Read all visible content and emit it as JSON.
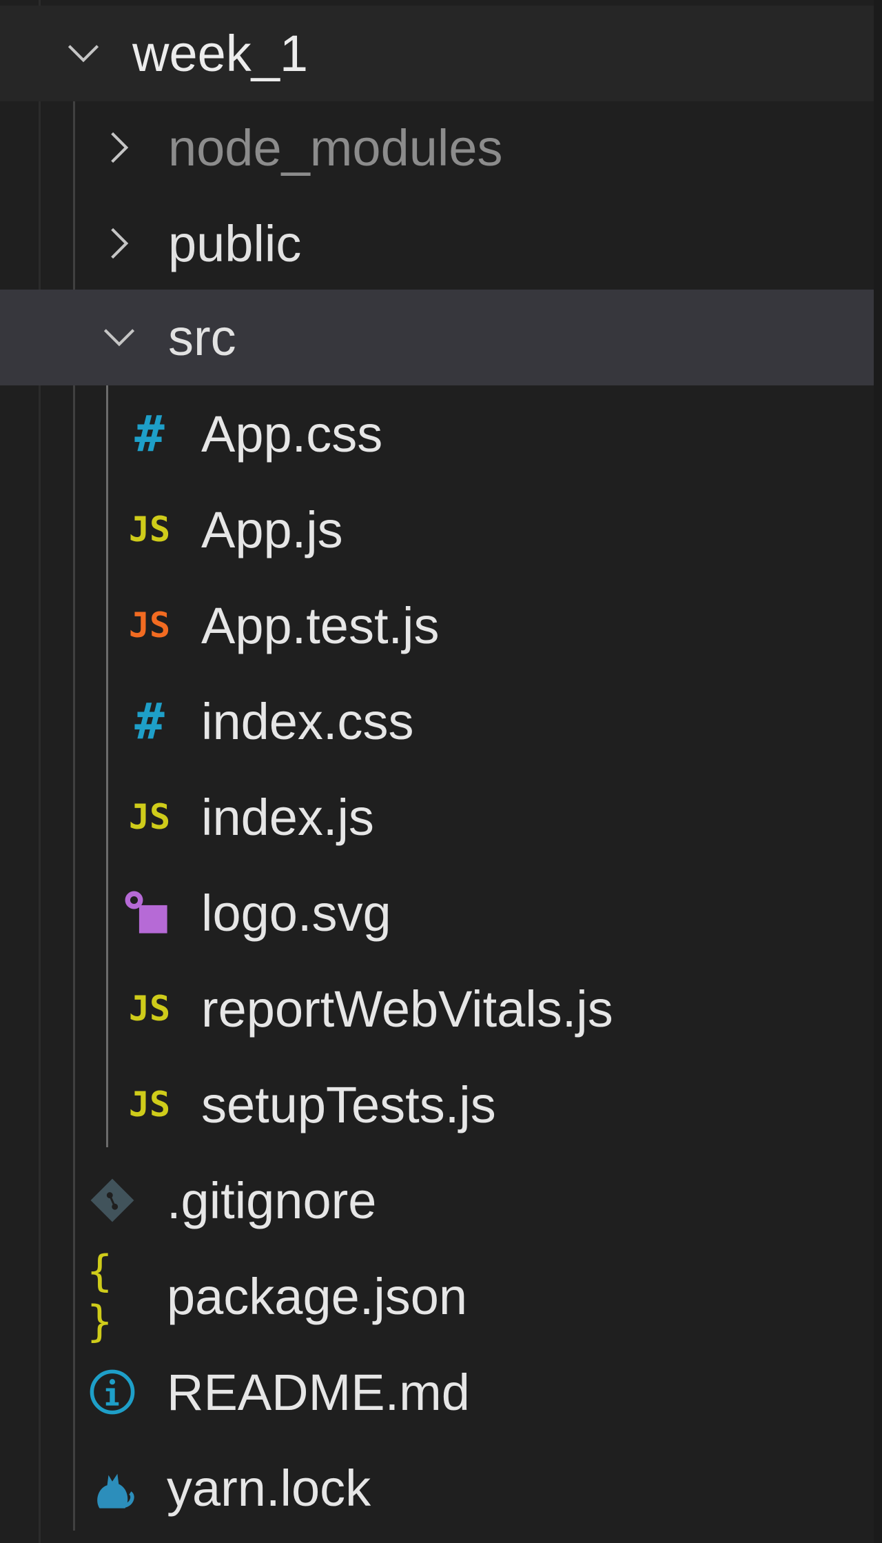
{
  "explorer": {
    "root": {
      "name": "week_1",
      "expanded": true
    },
    "folders": [
      {
        "name": "node_modules",
        "expanded": false,
        "ignored": true
      },
      {
        "name": "public",
        "expanded": false
      },
      {
        "name": "src",
        "expanded": true,
        "selected": true
      }
    ],
    "src_files": [
      {
        "name": "App.css",
        "icon": "css-hash-icon",
        "icon_glyph": "#",
        "icon_color": "#1e9fc8"
      },
      {
        "name": "App.js",
        "icon": "js-icon",
        "icon_glyph": "JS",
        "icon_color": "#cfcc1a"
      },
      {
        "name": "App.test.js",
        "icon": "js-test-icon",
        "icon_glyph": "JS",
        "icon_color": "#f26b21"
      },
      {
        "name": "index.css",
        "icon": "css-hash-icon",
        "icon_glyph": "#",
        "icon_color": "#1e9fc8"
      },
      {
        "name": "index.js",
        "icon": "js-icon",
        "icon_glyph": "JS",
        "icon_color": "#cfcc1a"
      },
      {
        "name": "logo.svg",
        "icon": "svg-image-icon",
        "icon_glyph": "",
        "icon_color": "#b66ad6"
      },
      {
        "name": "reportWebVitals.js",
        "icon": "js-icon",
        "icon_glyph": "JS",
        "icon_color": "#cfcc1a"
      },
      {
        "name": "setupTests.js",
        "icon": "js-icon",
        "icon_glyph": "JS",
        "icon_color": "#cfcc1a"
      }
    ],
    "root_files": [
      {
        "name": ".gitignore",
        "icon": "git-diamond-icon",
        "icon_color": "#41535b"
      },
      {
        "name": "package.json",
        "icon": "json-braces-icon",
        "icon_glyph": "{ }",
        "icon_color": "#cfcc1a"
      },
      {
        "name": "README.md",
        "icon": "info-circle-icon",
        "icon_glyph": "i",
        "icon_color": "#1e9fc8"
      },
      {
        "name": "yarn.lock",
        "icon": "yarn-cat-icon",
        "icon_color": "#2c8ebb"
      }
    ],
    "colors": {
      "background": "#1f1f1f",
      "header_row": "#262626",
      "selected_row": "#37373d",
      "text": "#e2e2e2",
      "ignored_text": "#8c8c8c"
    }
  }
}
